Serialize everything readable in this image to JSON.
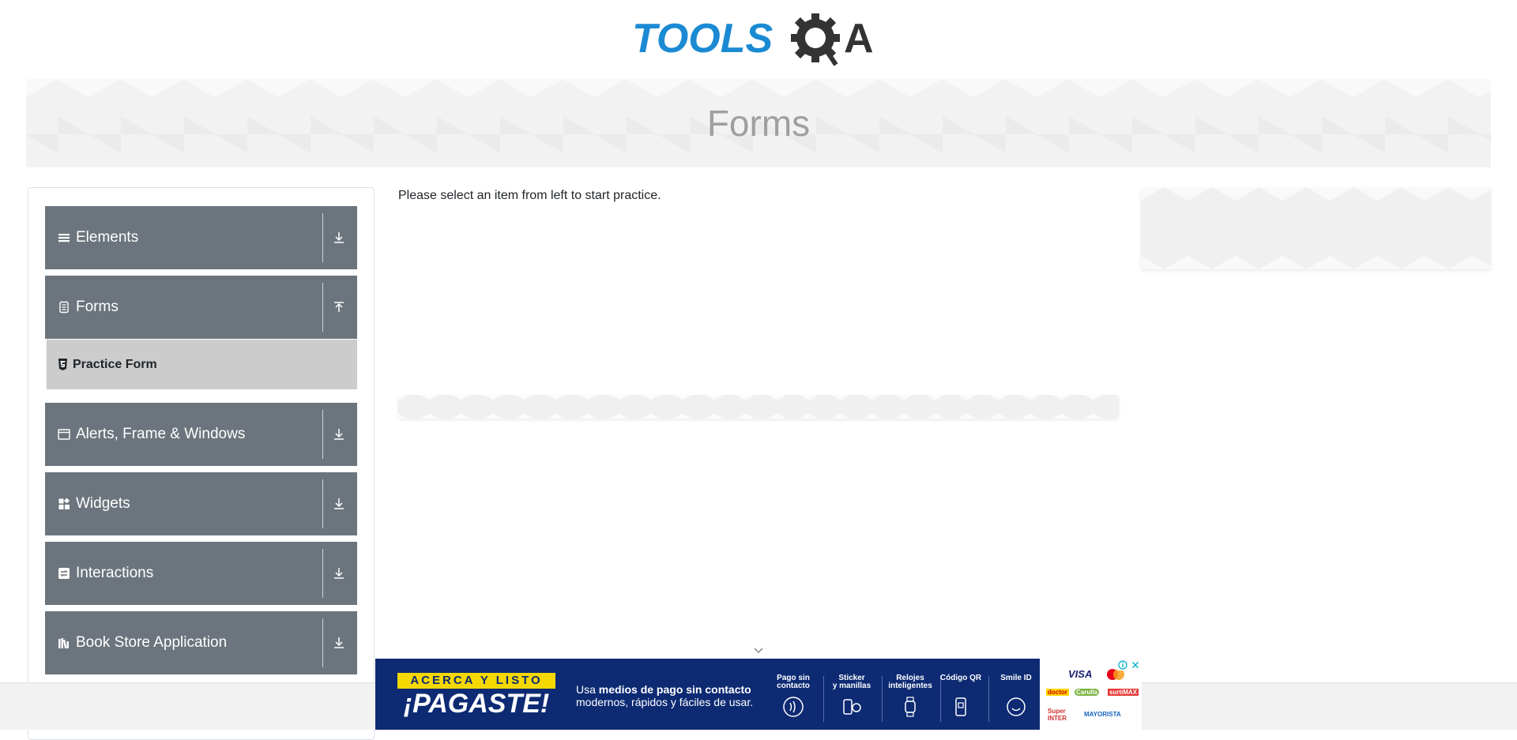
{
  "header": {
    "logo_text_left": "TOOLS",
    "logo_text_right": "QA"
  },
  "banner": {
    "title": "Forms"
  },
  "sidebar": {
    "groups": [
      {
        "label": "Elements",
        "icon": "list-icon",
        "expanded": false
      },
      {
        "label": "Forms",
        "icon": "document-icon",
        "expanded": true
      },
      {
        "label": "Alerts, Frame & Windows",
        "icon": "window-icon",
        "expanded": false
      },
      {
        "label": "Widgets",
        "icon": "widgets-icon",
        "expanded": false
      },
      {
        "label": "Interactions",
        "icon": "interactions-icon",
        "expanded": false
      },
      {
        "label": "Book Store Application",
        "icon": "book-icon",
        "expanded": false
      }
    ],
    "subitems": [
      {
        "label": "Practice Form",
        "icon": "html5-icon"
      }
    ]
  },
  "main": {
    "instruction": "Please select an item from left to start practice."
  },
  "ad": {
    "promo_top": "ACERCA Y LISTO",
    "promo_main": "¡PAGASTE!",
    "tagline_prefix": "Usa ",
    "tagline_bold": "medios de pago sin contacto",
    "tagline_line2": "modernos, rápidos y fáciles de usar.",
    "features": [
      {
        "label": "Pago sin contacto",
        "line1": "Pago sin",
        "line2": "contacto",
        "icon": "contactless-icon"
      },
      {
        "label": "Sticker y manillas",
        "line1": "Sticker",
        "line2": "y manillas",
        "icon": "sticker-icon"
      },
      {
        "label": "Relojes inteligentes",
        "line1": "Relojes",
        "line2": "inteligentes",
        "icon": "smartwatch-icon"
      },
      {
        "label": "Código QR",
        "line1": "Código QR",
        "line2": "",
        "icon": "qr-icon"
      },
      {
        "label": "Smile ID",
        "line1": "Smile ID",
        "line2": "",
        "icon": "smile-id-icon"
      }
    ],
    "brands": [
      "VISA",
      "doctor",
      "Carulla",
      "surtiMAX",
      "Super INTER",
      "MAYORISTA"
    ],
    "colors": {
      "background": "#0d2a73",
      "accent": "#f5d800"
    }
  },
  "colors": {
    "sidebar_group": "#6c757d",
    "subitem_active": "#cccccc",
    "logo_blue": "#1b8ad3",
    "logo_dark": "#333333"
  }
}
